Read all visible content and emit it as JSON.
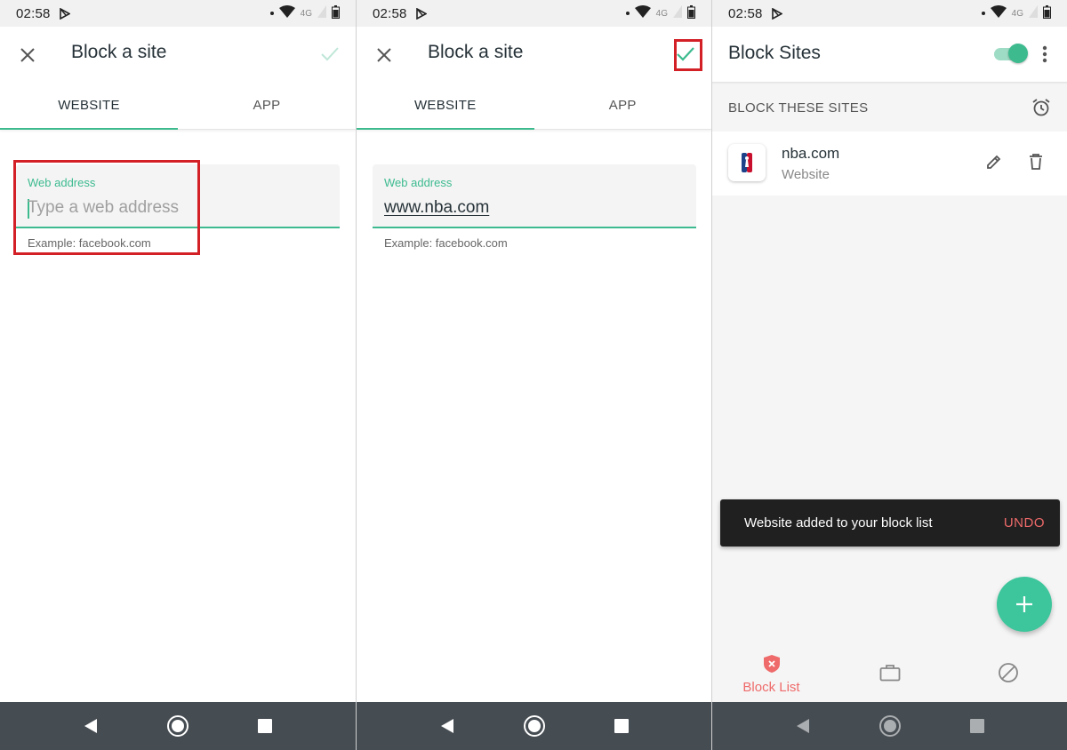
{
  "status_bar": {
    "time": "02:58",
    "network": "4G"
  },
  "colors": {
    "accent": "#3dbb8f",
    "highlight": "#d32027",
    "danger": "#ef6a6a"
  },
  "screen1": {
    "title": "Block a site",
    "tabs": [
      {
        "label": "WEBSITE",
        "active": true
      },
      {
        "label": "APP",
        "active": false
      }
    ],
    "field_label": "Web address",
    "field_placeholder": "Type a web address",
    "helper": "Example: facebook.com"
  },
  "screen2": {
    "title": "Block a site",
    "tabs": [
      {
        "label": "WEBSITE",
        "active": true
      },
      {
        "label": "APP",
        "active": false
      }
    ],
    "field_label": "Web address",
    "field_value": "www.nba.com",
    "helper": "Example: facebook.com"
  },
  "screen3": {
    "title": "Block Sites",
    "toggle_on": true,
    "section_title": "BLOCK THESE SITES",
    "items": [
      {
        "name": "nba.com",
        "type": "Website",
        "icon": "nba-logo"
      }
    ],
    "snackbar": {
      "message": "Website added to your block list",
      "action": "UNDO"
    },
    "bottom_nav": [
      {
        "label": "Block List",
        "icon": "shield-x-icon",
        "active": true
      },
      {
        "label": "",
        "icon": "briefcase-icon",
        "active": false
      },
      {
        "label": "",
        "icon": "block-icon",
        "active": false
      }
    ]
  }
}
